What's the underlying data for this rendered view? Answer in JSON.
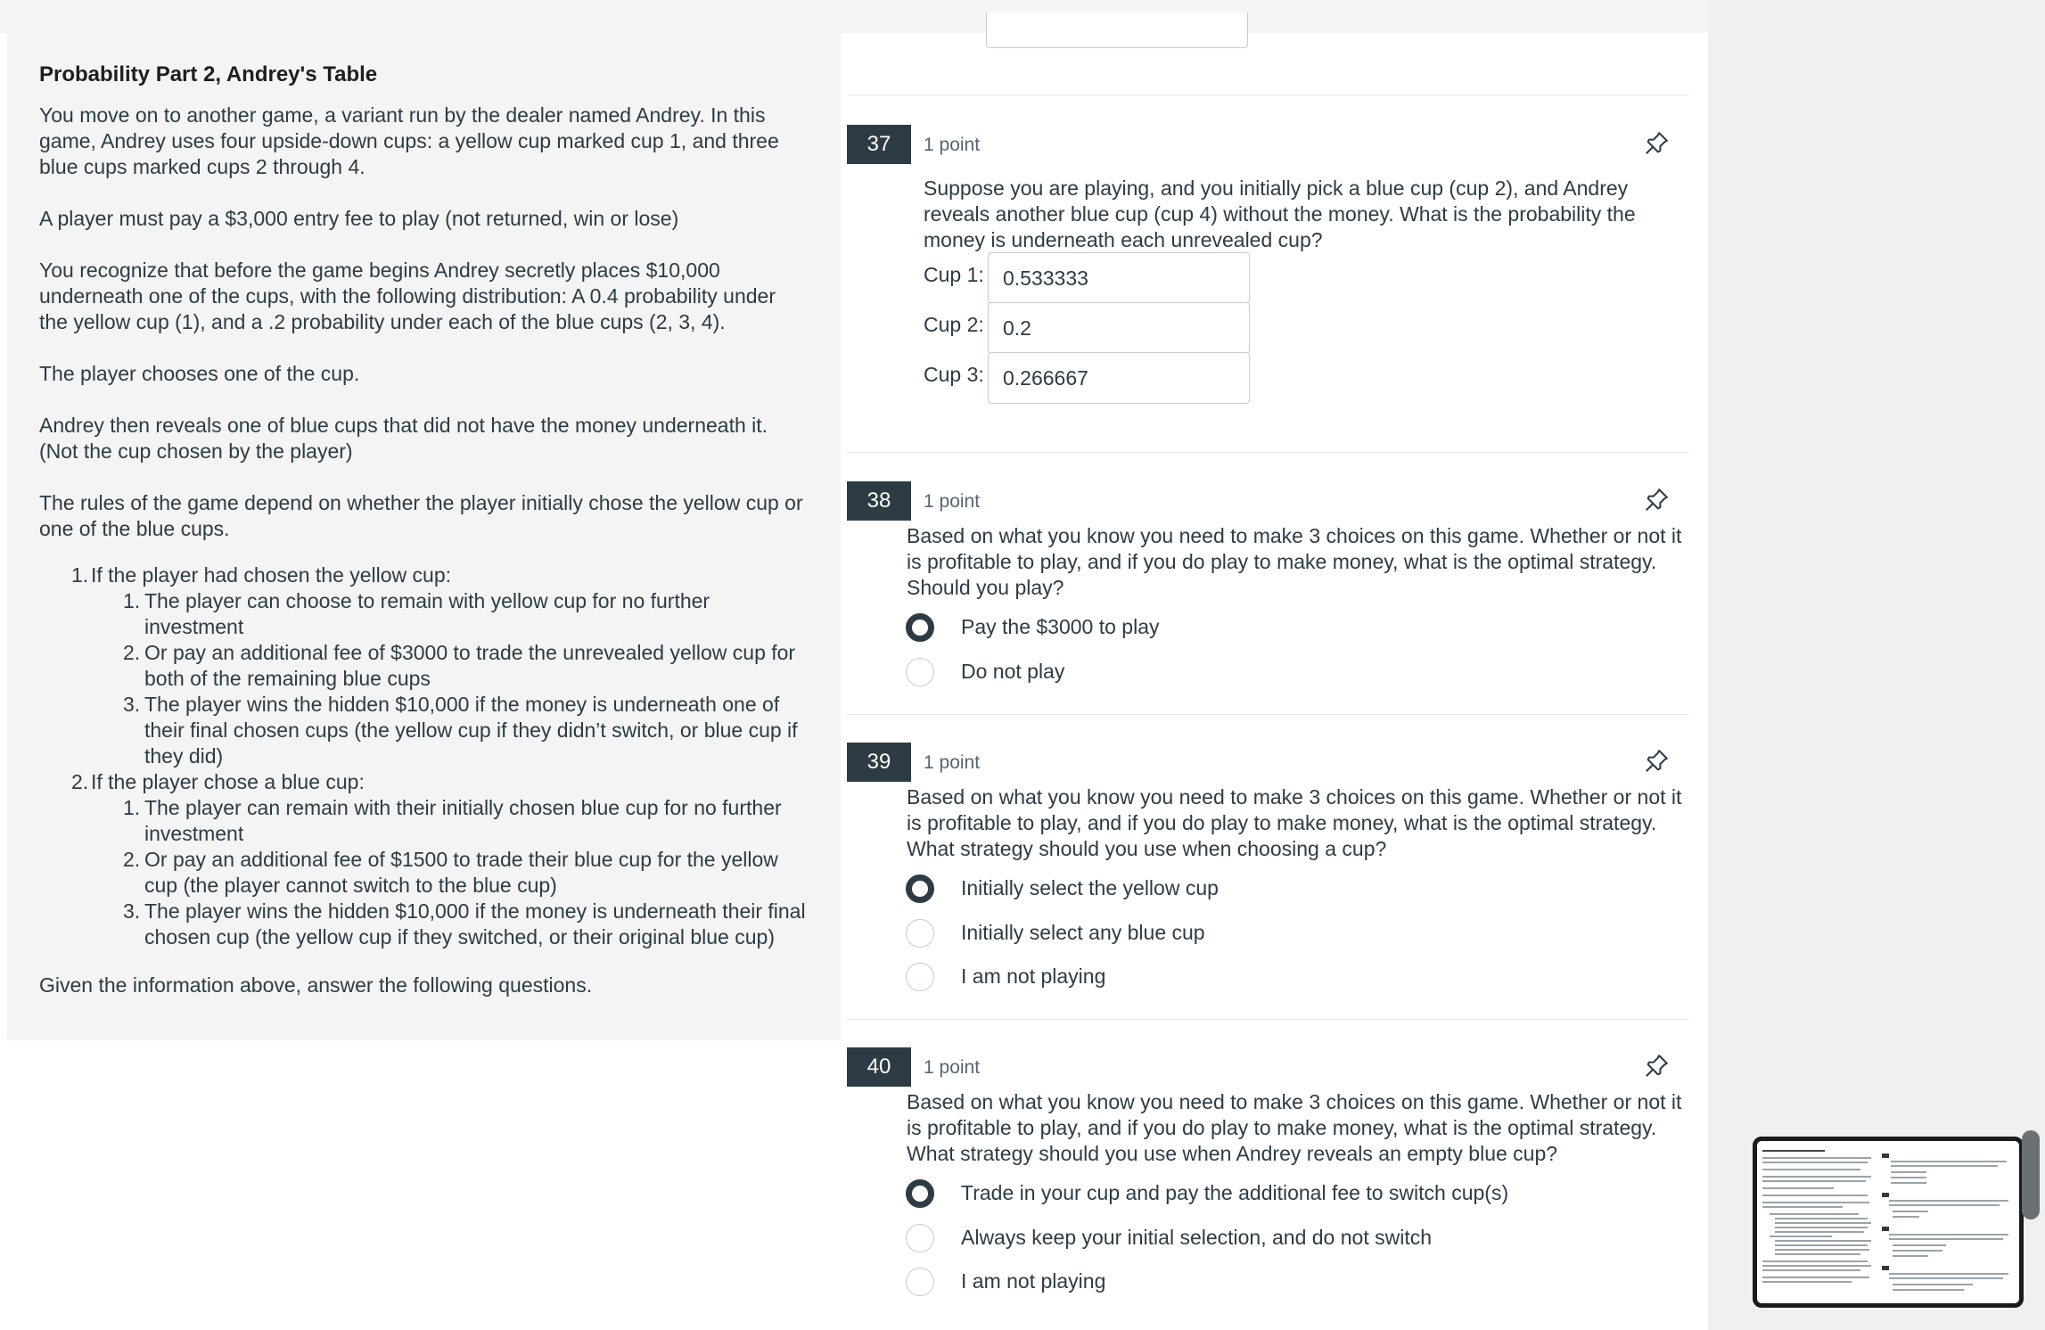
{
  "stimulus": {
    "title": "Probability Part 2, Andrey's Table",
    "p1": "You move on to another game, a variant run by the dealer named Andrey.  In this game, Andrey uses four upside-down cups: a yellow cup marked cup 1, and three blue cups marked cups 2 through 4.",
    "p2": "A player must pay a $3,000 entry fee to play (not returned, win or lose)",
    "p3": "You recognize that before the game begins Andrey secretly places $10,000 underneath one of the cups, with the following distribution: A 0.4 probability under the yellow cup (1), and a .2 probability under each of the blue cups (2, 3, 4).",
    "p4": "The player chooses one of the cup.",
    "p5": "Andrey then reveals one of blue cups that did not have the money underneath it. (Not the cup chosen by the player)",
    "p6": "The rules of the game depend on whether the player initially chose the yellow cup or one of the blue cups.",
    "rules": [
      {
        "num": "1.",
        "text": "If the player had chosen the yellow cup:",
        "sub": [
          {
            "num": "1.",
            "text": "The player can choose to remain with yellow cup for no further investment"
          },
          {
            "num": "2.",
            "text": "Or pay an additional fee of $3000 to trade the unrevealed yellow cup for both of the remaining blue cups"
          },
          {
            "num": "3.",
            "text": "The player wins the hidden $10,000 if the money is underneath one of their final chosen cups (the yellow cup if they didn’t switch, or blue cup if they did)"
          }
        ]
      },
      {
        "num": "2.",
        "text": "If the player chose a blue cup:",
        "sub": [
          {
            "num": "1.",
            "text": "The player can remain with their initially chosen blue cup for no further investment"
          },
          {
            "num": "2.",
            "text": "Or pay an additional fee of $1500 to trade their blue cup for the yellow cup (the player cannot switch to the blue cup)"
          },
          {
            "num": "3.",
            "text": "The player wins the hidden $10,000 if the money is underneath their final chosen cup (the yellow cup if they switched, or their original blue cup)"
          }
        ]
      }
    ],
    "p7": "Given the information above, answer the following questions."
  },
  "questions": [
    {
      "number": "37",
      "points": "1 point",
      "text": "Suppose you are playing, and you initially pick a blue cup (cup 2), and Andrey reveals another blue cup (cup 4) without the money.  What is the probability the money is underneath each unrevealed cup?",
      "fields": [
        {
          "label": "Cup 1:",
          "value": "0.533333"
        },
        {
          "label": "Cup 2:",
          "value": "0.2"
        },
        {
          "label": "Cup 3:",
          "value": "0.266667"
        }
      ]
    },
    {
      "number": "38",
      "points": "1 point",
      "text": "Based on what you know you need to make 3 choices on this game. Whether or not it is profitable to play, and if you do play to make money, what is the optimal strategy. Should you play?",
      "options": [
        {
          "label": "Pay the $3000 to play",
          "selected": true
        },
        {
          "label": "Do not play",
          "selected": false
        }
      ]
    },
    {
      "number": "39",
      "points": "1 point",
      "text": "Based on what you know you need to make 3 choices on this game. Whether or not it is profitable to play, and if you do play to make money, what is the optimal strategy. What strategy should you use when choosing a cup?",
      "options": [
        {
          "label": "Initially select the yellow cup",
          "selected": true
        },
        {
          "label": "Initially select any blue cup",
          "selected": false
        },
        {
          "label": "I am not playing",
          "selected": false
        }
      ]
    },
    {
      "number": "40",
      "points": "1 point",
      "text": "Based on what you know you need to make 3 choices on this game. Whether or not it is profitable to play, and if you do play to make money, what is the optimal strategy. What strategy should you use when Andrey reveals an empty blue cup?",
      "options": [
        {
          "label": "Trade in your cup and pay the additional fee to switch cup(s)",
          "selected": true
        },
        {
          "label": "Always keep your initial selection, and do not switch",
          "selected": false
        },
        {
          "label": "I am not playing",
          "selected": false
        }
      ]
    }
  ],
  "icons": {
    "pin": "pin-icon",
    "radio_selected": "radio-selected",
    "radio_unselected": "radio-unselected"
  },
  "colors": {
    "question_badge": "#2d3b45",
    "text": "#2d3b45",
    "stimulus_bg": "#f4f4f4"
  }
}
